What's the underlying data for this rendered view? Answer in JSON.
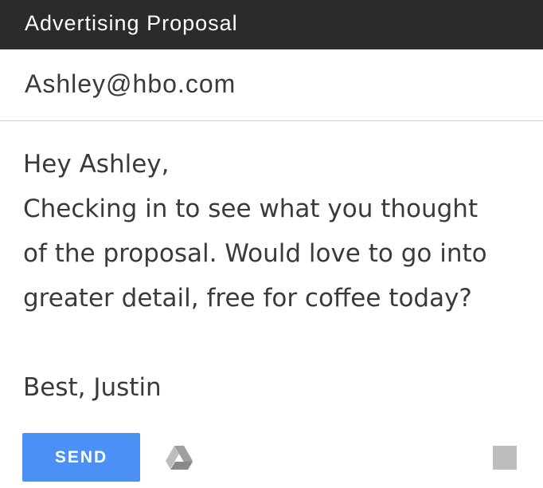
{
  "header": {
    "subject": "Advertising Proposal"
  },
  "recipient": {
    "to": "Ashley@hbo.com"
  },
  "message": {
    "lines": [
      "Hey Ashley,",
      "Checking in to see what you thought",
      "of the proposal. Would love to go into",
      "greater detail, free for coffee today?",
      "",
      "Best, Justin"
    ]
  },
  "toolbar": {
    "send_label": "SEND",
    "drive_icon": "google-drive-icon",
    "square_icon": "gray-square-icon"
  },
  "colors": {
    "header_bg": "#2b2b2b",
    "send_bg": "#4a90f5",
    "text": "#3a3a3a"
  }
}
